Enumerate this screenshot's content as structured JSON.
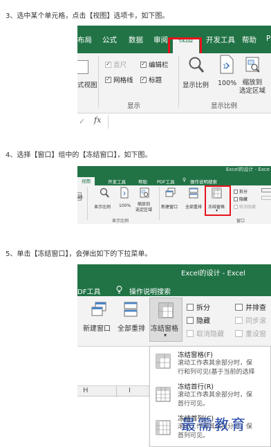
{
  "steps": {
    "step3": "3、选中某个单元格，点击【视图】选项卡，如下图。",
    "step4": "4、选择【窗口】组中的【冻结窗口】，如下图。",
    "step5": "5、单击【冻结窗口】，会弹出如下的下拉菜单。"
  },
  "shot1": {
    "tabs": [
      "布局",
      "公式",
      "数据",
      "审阅",
      "视图",
      "开发工具",
      "帮助",
      "P"
    ],
    "active_tab": "视图",
    "view_left": "式视图",
    "checks": {
      "ruler": "直尺",
      "formula_bar": "编辑栏",
      "gridlines": "网格线",
      "headings": "标题"
    },
    "group_show": "显示",
    "zoom": "显示比例",
    "zoom100": "100%",
    "zoom_sel": "缩放到\n选定区域",
    "group_zoom": "显示比例",
    "fx": "fx"
  },
  "shot2": {
    "tabs": [
      "视图",
      "开发工具",
      "帮助",
      "PDF工具",
      "操作说明搜索"
    ],
    "title": "Excel的设计 - Exce",
    "zoom": "显示比例",
    "zoom100": "100%",
    "zoom_sel": "缩放到\n选定区域",
    "new_window": "新建窗口",
    "arrange_all": "全部重排",
    "freeze": "冻结窗格",
    "split": "拆分",
    "hide": "隐藏",
    "unhide": "取消隐藏",
    "group_zoom": "显示比例",
    "group_window": "窗口"
  },
  "shot3": {
    "title": "Excel的设计  -  Excel",
    "tab_pdf": "DF工具",
    "tell_me": "操作说明搜索",
    "new_window": "新建窗口",
    "arrange_all": "全部重排",
    "freeze": "冻结窗格",
    "split": "拆分",
    "hide": "隐藏",
    "unhide": "取消隐藏",
    "side_by_side": "并排查",
    "sync_scroll": "同步滚",
    "reset_pos": "重设窗",
    "col_h": "H",
    "col_i": "I",
    "menu": [
      {
        "title": "冻结窗格(F)",
        "desc1": "滚动工作表其余部分时，保",
        "desc2": "行和列可见(基于当前的选择"
      },
      {
        "title": "冻结首行(R)",
        "desc1": "滚动工作表其余部分时，保",
        "desc2": "首行可见。"
      },
      {
        "title": "冻结首列(C)",
        "desc1": "滚动工作表其余部分时，保",
        "desc2": "首列可见。"
      }
    ],
    "watermark": "最需教育"
  },
  "colors": {
    "ribbon_green": "#217346",
    "highlight_red": "#e8121b",
    "watermark_blue": "#2348a8"
  }
}
